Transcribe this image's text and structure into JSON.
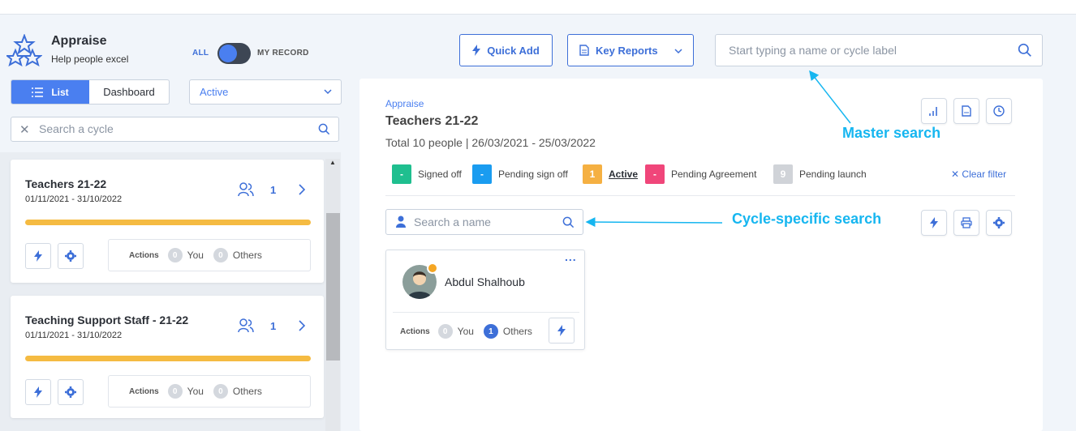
{
  "brand": {
    "title": "Appraise",
    "subtitle": "Help people excel"
  },
  "record_toggle": {
    "left_label": "ALL",
    "right_label": "MY RECORD"
  },
  "view_switch": {
    "list_label": "List",
    "dashboard_label": "Dashboard"
  },
  "status_select": {
    "value": "Active"
  },
  "cycle_search": {
    "placeholder": "Search a cycle"
  },
  "cycles": [
    {
      "title": "Teachers 21-22",
      "dates": "01/11/2021 - 31/10/2022",
      "count": "1",
      "actions_label": "Actions",
      "you_count": "0",
      "you_label": "You",
      "others_count": "0",
      "others_label": "Others"
    },
    {
      "title": "Teaching Support Staff - 21-22",
      "dates": "01/11/2021 - 31/10/2022",
      "count": "1",
      "actions_label": "Actions",
      "you_count": "0",
      "you_label": "You",
      "others_count": "0",
      "others_label": "Others"
    }
  ],
  "toolbar": {
    "quick_add": "Quick Add",
    "key_reports": "Key Reports"
  },
  "master_search": {
    "placeholder": "Start typing a name or cycle label"
  },
  "detail": {
    "breadcrumb": "Appraise",
    "title": "Teachers 21-22",
    "summary": "Total 10 people | 26/03/2021 - 25/03/2022",
    "statuses": [
      {
        "count": "-",
        "label": "Signed off",
        "color": "#1fbf8f"
      },
      {
        "count": "-",
        "label": "Pending sign off",
        "color": "#1a9cf0"
      },
      {
        "count": "1",
        "label": "Active",
        "color": "#f5b042"
      },
      {
        "count": "-",
        "label": "Pending Agreement",
        "color": "#f0467a"
      },
      {
        "count": "9",
        "label": "Pending launch",
        "color": "#d0d3d8"
      }
    ],
    "clear_filter": "Clear filter",
    "name_search_placeholder": "Search a name",
    "person": {
      "name": "Abdul Shalhoub",
      "more": "...",
      "actions_label": "Actions",
      "you_count": "0",
      "you_label": "You",
      "others_count": "1",
      "others_label": "Others"
    }
  },
  "annotations": {
    "master": "Master search",
    "cycle": "Cycle-specific search"
  },
  "colors": {
    "accent": "#3d6fd8",
    "primary": "#4a7ff0",
    "progress": "#f5bb42",
    "annotation": "#16b6f0"
  }
}
